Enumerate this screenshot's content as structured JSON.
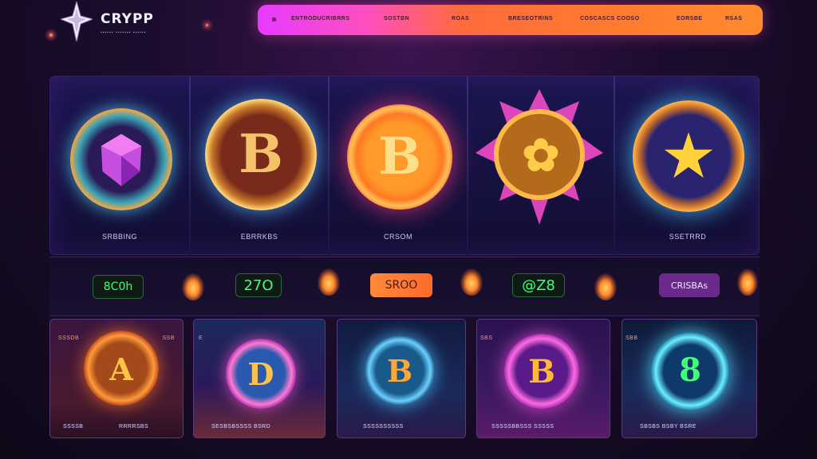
{
  "header": {
    "logo_text": "CRYPP",
    "logo_tagline": "▪▪▪▪▪▪ ▪▪▪▪▪▪▪ ▪▪▪▪▪▪"
  },
  "nav": {
    "items": [
      "ENTRODUCRIBRRS",
      "SOSTBN",
      "ROAS",
      "BRESEOTRINS",
      "COSCASCS COOSO",
      "EORSBE",
      "RSAS"
    ]
  },
  "featured": {
    "coins": [
      {
        "label": "SRBBING",
        "glyph": "◆"
      },
      {
        "label": "EBRRKBS",
        "glyph": "B"
      },
      {
        "label": "CRSOM",
        "glyph": "B"
      },
      {
        "label": "",
        "glyph": "✿"
      },
      {
        "label": "SSETRRD",
        "glyph": "★"
      }
    ]
  },
  "ticker": {
    "values": [
      "8C0h",
      "27O",
      "SROO",
      "@Z8",
      "CRISBAs"
    ]
  },
  "cards": [
    {
      "top_left": "SSSDB",
      "top_right": "SSB",
      "bottom_left": "SSSSB",
      "bottom_right": "RRRRSBS",
      "glyph": "A"
    },
    {
      "top_left": "E",
      "top_right": "",
      "bottom_left": "SESBSBSSSS BSRD",
      "bottom_right": "",
      "glyph": "D"
    },
    {
      "top_left": "",
      "top_right": "",
      "bottom_left": "SSSSSSSSSS",
      "bottom_right": "",
      "glyph": "B"
    },
    {
      "top_left": "SBS",
      "top_right": "",
      "bottom_left": "SSSSSBBSSS SSSSS",
      "bottom_right": "",
      "glyph": "B"
    },
    {
      "top_left": "SBB",
      "top_right": "",
      "bottom_left": "SBSBS BSBY BSRE",
      "bottom_right": "",
      "glyph": "8"
    }
  ],
  "colors": {
    "accent_pink": "#ff4fbf",
    "accent_orange": "#ff7a2e",
    "ticker_green": "#42ff7a"
  }
}
